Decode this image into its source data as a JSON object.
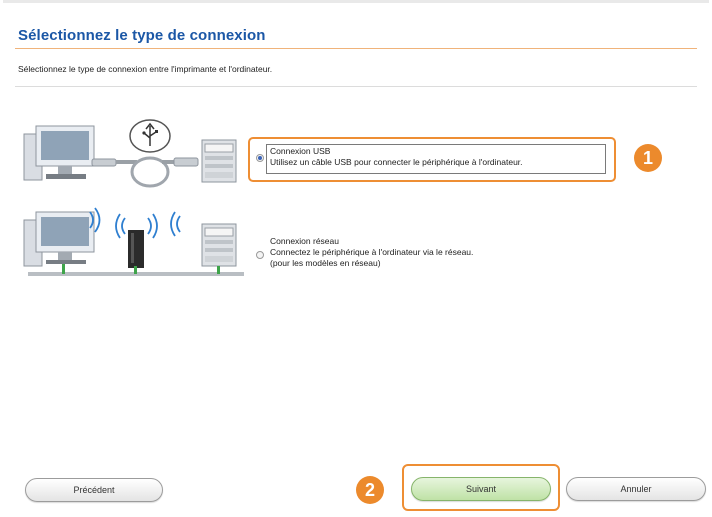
{
  "dialog": {
    "title": "Sélectionnez le type de connexion",
    "subtitle": "Sélectionnez le type de connexion entre l'imprimante et l'ordinateur."
  },
  "options": [
    {
      "label": "Connexion USB",
      "description": "Utilisez un câble USB pour connecter le périphérique à l'ordinateur.",
      "selected": true
    },
    {
      "label": "Connexion réseau",
      "description": "Connectez le périphérique à l'ordinateur via le réseau.",
      "note": "(pour les modèles en réseau)",
      "selected": false
    }
  ],
  "callouts": {
    "step1": "1",
    "step2": "2",
    "color": "#ec8a2c"
  },
  "buttons": {
    "previous": "Précédent",
    "next": "Suivant",
    "cancel": "Annuler"
  },
  "icons": [
    "computer-icon",
    "usb-symbol-icon",
    "usb-cable-icon",
    "printer-icon",
    "wifi-icon",
    "router-icon"
  ]
}
